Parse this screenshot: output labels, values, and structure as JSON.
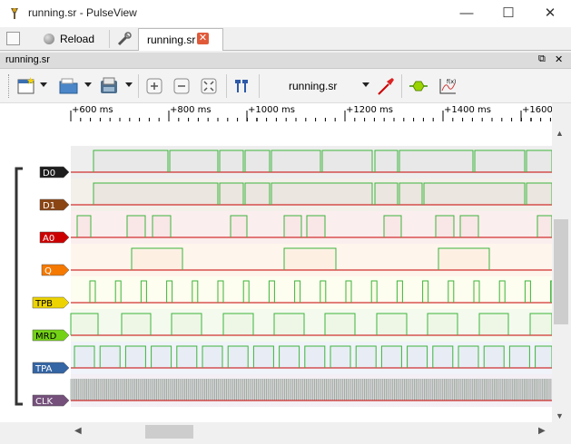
{
  "window": {
    "title": "running.sr - PulseView"
  },
  "tabs": {
    "reload_label": "Reload",
    "document_tab": "running.sr"
  },
  "dock": {
    "title": "running.sr"
  },
  "toolbar": {
    "device_select": "running.sr"
  },
  "ruler": {
    "ticks": [
      "+600 ms",
      "+800 ms",
      "+1000 ms",
      "+1200 ms",
      "+1400 ms",
      "+1600 ms"
    ]
  },
  "channels": [
    {
      "name": "D0",
      "color": "#1e1e1e",
      "bg": "#e8e8e8",
      "band": "#eeeeee"
    },
    {
      "name": "D1",
      "color": "#8b4513",
      "bg": "#ebe6df",
      "band": "#f3f0ea"
    },
    {
      "name": "A0",
      "color": "#cc0000",
      "bg": "#f9e6e6",
      "band": "#fbeeee"
    },
    {
      "name": "Q",
      "color": "#f57900",
      "bg": "#fdf0e3",
      "band": "#fef5ec"
    },
    {
      "name": "TPB",
      "color": "#edd400",
      "bg": "#fbfbe6",
      "band": "#fdfdf0"
    },
    {
      "name": "MRD",
      "color": "#73d216",
      "bg": "#eef7e6",
      "band": "#f4faee"
    },
    {
      "name": "TPA",
      "color": "#3465a4",
      "bg": "#e8edf5",
      "band": "#f0f3f9"
    },
    {
      "name": "CLK",
      "color": "#75507b",
      "bg": "#ece6ee",
      "band": "#f3eff4"
    }
  ],
  "colors": {
    "high": "#3cb43c",
    "low": "#c80000",
    "accent_red": "#d9534f"
  }
}
